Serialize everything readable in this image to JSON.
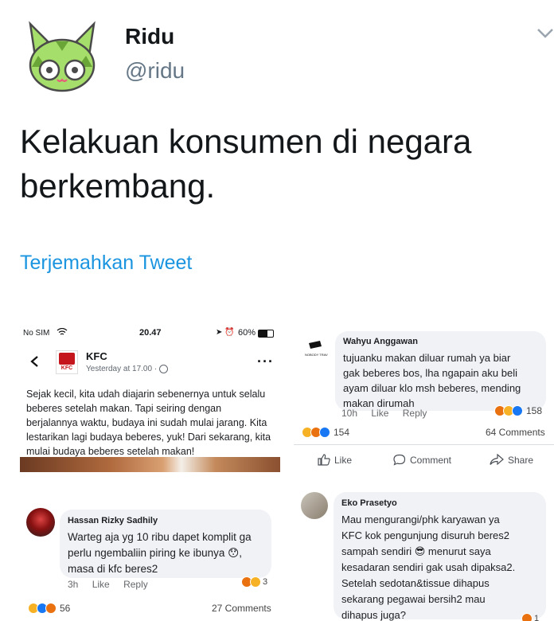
{
  "tweet": {
    "name": "Ridu",
    "handle": "@ridu",
    "text_line1": "Kelakuan konsumen di negara",
    "text_line2": "berkembang.",
    "translate_label": "Terjemahkan Tweet"
  },
  "panel1": {
    "status_carrier": "No SIM",
    "status_time": "20.47",
    "status_battery": "60%",
    "page_name": "KFC",
    "post_time": "Yesterday at 17.00 ·",
    "logo_text": "KFC",
    "post_text": "Sejak kecil, kita udah diajarin sebenernya untuk selalu beberes setelah makan. Tapi seiring dengan berjalannya waktu, budaya ini sudah mulai jarang. Kita lestarikan lagi budaya beberes, yuk! Dari sekarang, kita mulai budaya beberes setelah makan!"
  },
  "panel2": {
    "commenter": "Wahyu Anggawan",
    "comment_line1": "tujuanku makan diluar rumah ya biar",
    "comment_line2": "gak beberes bos, lha ngapain aku beli",
    "comment_line3": "ayam diluar klo msh beberes, mending",
    "comment_line4": "makan dirumah",
    "time": "10h",
    "like_label": "Like",
    "reply_label": "Reply",
    "comment_reactions": "158",
    "post_reactions": "154",
    "comments_count": "64 Comments",
    "action_like": "Like",
    "action_comment": "Comment",
    "action_share": "Share"
  },
  "panel3": {
    "commenter": "Hassan Rizky Sadhily",
    "comment_line1": "Warteg aja yg 10 ribu dapet komplit ga",
    "comment_line2": "perlu ngembaliin piring ke ibunya 😯,",
    "comment_line3": "masa di kfc beres2",
    "time": "3h",
    "like_label": "Like",
    "reply_label": "Reply",
    "comment_reactions": "3",
    "post_reactions": "56",
    "comments_count": "27 Comments"
  },
  "panel4": {
    "commenter": "Eko Prasetyo",
    "comment_line1": "Mau mengurangi/phk karyawan ya",
    "comment_line2": "KFC kok pengunjung disuruh beres2",
    "comment_line3": "sampah sendiri 😎 menurut saya",
    "comment_line4": "kesadaran sendiri gak usah dipaksa2.",
    "comment_line5": "Setelah sedotan&tissue dihapus",
    "comment_line6": "sekarang pegawai bersih2 mau",
    "comment_line7": "dihapus juga?",
    "comment_reactions": "1"
  },
  "colors": {
    "handle": "#657786",
    "link": "#1b95e0",
    "fb_blue": "#1877f2",
    "bubble": "#f0f2f5"
  }
}
